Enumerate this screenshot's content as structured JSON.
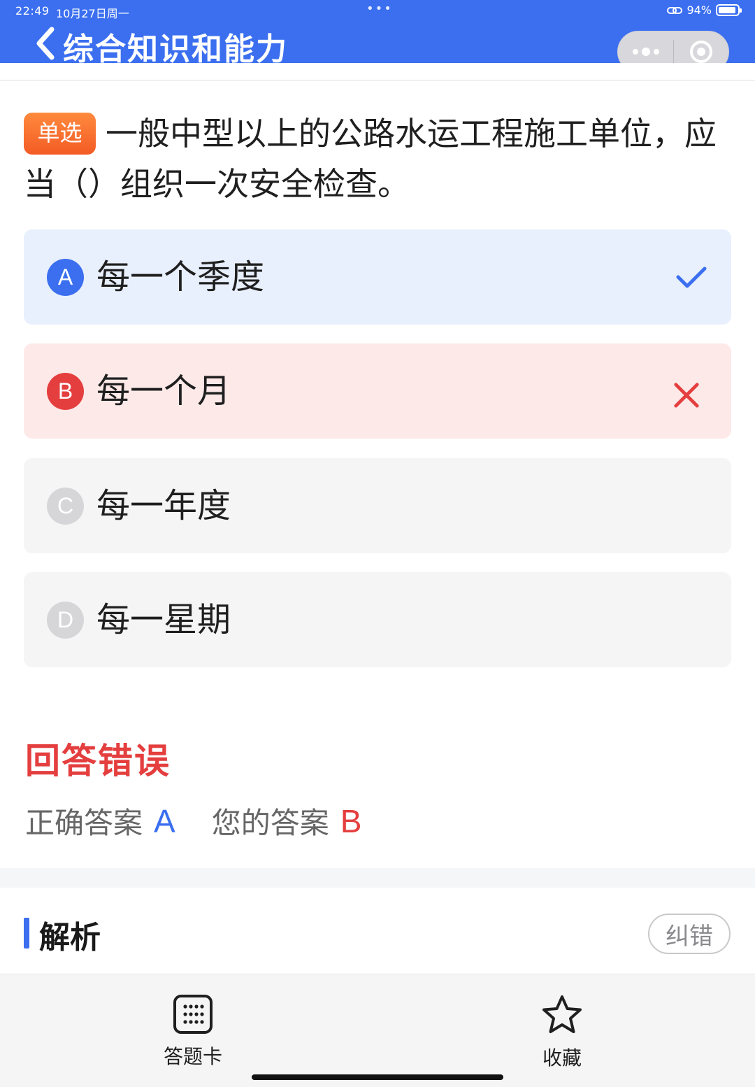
{
  "status_bar": {
    "time": "22:49",
    "date": "10月27日周一",
    "dots": "•••",
    "battery_text": "94%",
    "battery_level": 0.94
  },
  "header": {
    "title": "综合知识和能力",
    "more_icon": "more-dots-icon",
    "close_icon": "target-circle-icon"
  },
  "question": {
    "type_badge": "单选",
    "text": "一般中型以上的公路水运工程施工单位，应当（）组织一次安全检查。"
  },
  "options": [
    {
      "letter": "A",
      "text": "每一个季度",
      "state": "correct",
      "icon": "check-icon"
    },
    {
      "letter": "B",
      "text": "每一个月",
      "state": "wrong",
      "icon": "cross-icon"
    },
    {
      "letter": "C",
      "text": "每一年度",
      "state": "neutral"
    },
    {
      "letter": "D",
      "text": "每一星期",
      "state": "neutral"
    }
  ],
  "result": {
    "title": "回答错误",
    "correct_label": "正确答案",
    "correct_value": "A",
    "your_label": "您的答案",
    "your_value": "B"
  },
  "analysis": {
    "title": "解析",
    "report_button": "纠错"
  },
  "bottom_bar": {
    "card_label": "答题卡",
    "card_icon": "answer-sheet-icon",
    "fav_label": "收藏",
    "fav_icon": "star-icon"
  },
  "colors": {
    "primary": "#3b6ff0",
    "error": "#e43e3e",
    "badge": "#f35b25"
  }
}
